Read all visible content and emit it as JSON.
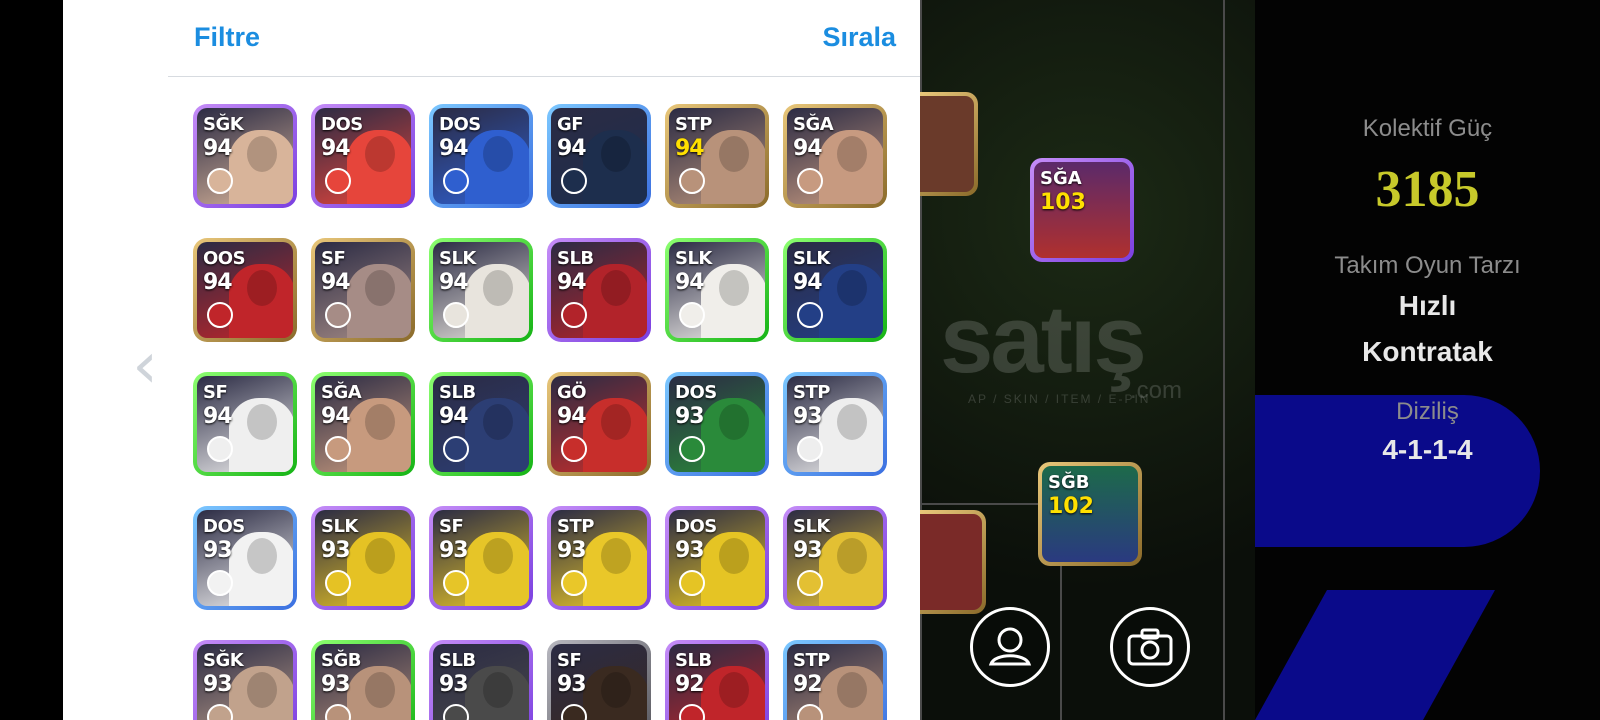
{
  "header": {
    "filter_label": "Filtre",
    "sort_label": "Sırala"
  },
  "nav": {
    "prev_glyph": "‹"
  },
  "cards": [
    {
      "pos": "SĞK",
      "rating": "94",
      "frame": "purple",
      "face": "#d8b49a"
    },
    {
      "pos": "DOS",
      "rating": "94",
      "frame": "purple",
      "face": "#e6453b"
    },
    {
      "pos": "DOS",
      "rating": "94",
      "frame": "blue",
      "face": "#2f5fcf"
    },
    {
      "pos": "GF",
      "rating": "94",
      "frame": "blue",
      "face": "#1d2e4d"
    },
    {
      "pos": "STP",
      "rating": "94",
      "frame": "gold",
      "gold": true,
      "face": "#b8927a"
    },
    {
      "pos": "SĞA",
      "rating": "94",
      "frame": "gold",
      "face": "#c79a80"
    },
    {
      "pos": "OOS",
      "rating": "94",
      "frame": "gold",
      "face": "#c0252a"
    },
    {
      "pos": "SF",
      "rating": "94",
      "frame": "gold",
      "face": "#a68c86"
    },
    {
      "pos": "SLK",
      "rating": "94",
      "frame": "green",
      "face": "#e8e4dd"
    },
    {
      "pos": "SLB",
      "rating": "94",
      "frame": "purple",
      "face": "#b2232a"
    },
    {
      "pos": "SLK",
      "rating": "94",
      "frame": "green",
      "face": "#f0eeea"
    },
    {
      "pos": "SLK",
      "rating": "94",
      "frame": "green",
      "face": "#233f86"
    },
    {
      "pos": "SF",
      "rating": "94",
      "frame": "green",
      "face": "#efefef"
    },
    {
      "pos": "SĞA",
      "rating": "94",
      "frame": "green",
      "face": "#c79a7e"
    },
    {
      "pos": "SLB",
      "rating": "94",
      "frame": "green",
      "face": "#2c3e74"
    },
    {
      "pos": "GÖ",
      "rating": "94",
      "frame": "gold",
      "face": "#c72e2b"
    },
    {
      "pos": "DOS",
      "rating": "93",
      "frame": "blue",
      "face": "#2a8a3a"
    },
    {
      "pos": "STP",
      "rating": "93",
      "frame": "blue",
      "face": "#eeeeee"
    },
    {
      "pos": "DOS",
      "rating": "93",
      "frame": "blue",
      "face": "#f2f2f2"
    },
    {
      "pos": "SLK",
      "rating": "93",
      "frame": "purple",
      "face": "#e5c224"
    },
    {
      "pos": "SF",
      "rating": "93",
      "frame": "purple",
      "face": "#e6c528"
    },
    {
      "pos": "STP",
      "rating": "93",
      "frame": "purple",
      "face": "#e9c729"
    },
    {
      "pos": "DOS",
      "rating": "93",
      "frame": "purple",
      "face": "#e5c424"
    },
    {
      "pos": "SLK",
      "rating": "93",
      "frame": "purple",
      "face": "#e3c033"
    },
    {
      "pos": "SĞK",
      "rating": "93",
      "frame": "purple",
      "face": "#c1a28c"
    },
    {
      "pos": "SĞB",
      "rating": "93",
      "frame": "green",
      "face": "#b8927a"
    },
    {
      "pos": "SLB",
      "rating": "93",
      "frame": "purple",
      "face": "#4a4a4a"
    },
    {
      "pos": "SF",
      "rating": "93",
      "frame": "dark",
      "face": "#3a2a20"
    },
    {
      "pos": "SLB",
      "rating": "92",
      "frame": "purple",
      "face": "#c0252a"
    },
    {
      "pos": "STP",
      "rating": "92",
      "frame": "blue",
      "face": "#b8927a"
    }
  ],
  "pitch_cards": [
    {
      "pos": "SĞA",
      "rating": "103",
      "frame": "purple"
    },
    {
      "pos": "SĞB",
      "rating": "102",
      "frame": "gold"
    }
  ],
  "stats": {
    "power_label": "Kolektif Güç",
    "power_value": "3185",
    "style_label": "Takım Oyun Tarzı",
    "style_value_1": "Hızlı",
    "style_value_2": "Kontratak",
    "formation_label": "Diziliş",
    "formation_value": "4-1-1-4"
  },
  "watermark": {
    "brand": "satış",
    "tagline": "AP / SKIN / ITEM / E-PIN",
    "suffix": ".com"
  },
  "icons": {
    "profile": "profile-icon",
    "camera": "camera-icon"
  }
}
